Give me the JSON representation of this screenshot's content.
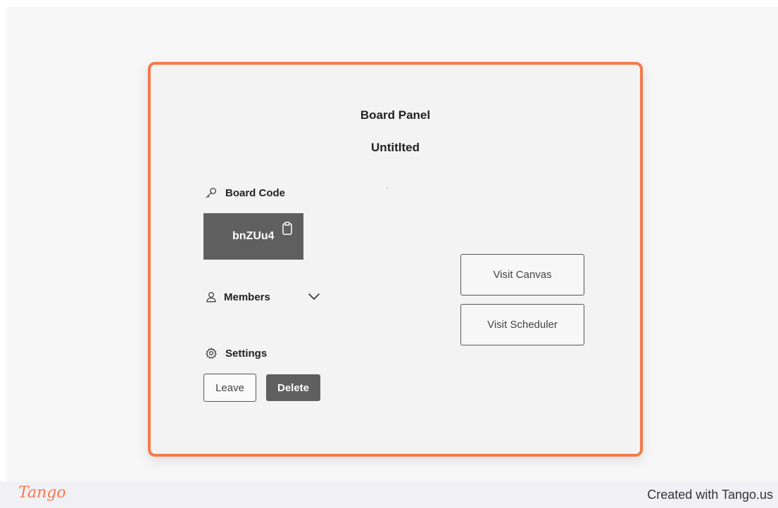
{
  "panel": {
    "heading": "Board Panel",
    "board_name": "Untitlted"
  },
  "board_code": {
    "label": "Board Code",
    "icon": "key-icon",
    "value": "bnZUu4",
    "copy_icon": "clipboard-icon"
  },
  "members": {
    "label": "Members",
    "icon": "user-icon",
    "toggle_icon": "chevron-down-icon"
  },
  "settings": {
    "label": "Settings",
    "icon": "gear-icon",
    "leave_label": "Leave",
    "delete_label": "Delete"
  },
  "actions": {
    "visit_canvas_label": "Visit Canvas",
    "visit_scheduler_label": "Visit Scheduler"
  },
  "footer": {
    "logo": "Tango",
    "credit": "Created with Tango.us"
  },
  "colors": {
    "accent": "#f47a4a",
    "code_bg": "#5f5f5f"
  }
}
